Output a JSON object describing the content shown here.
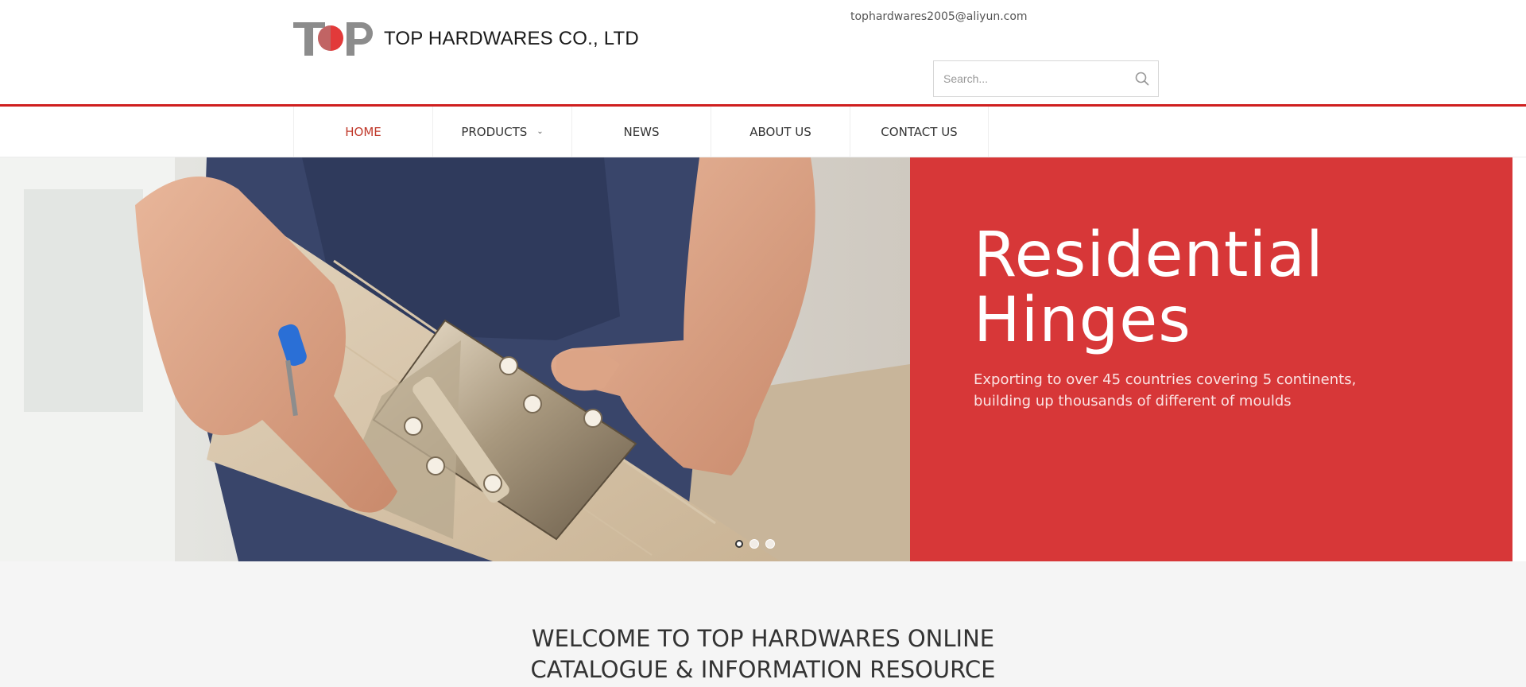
{
  "header": {
    "company_name": "TOP HARDWARES CO., LTD",
    "email": "tophardwares2005@aliyun.com",
    "search_placeholder": "Search...",
    "logo_letters": "TOP"
  },
  "nav": {
    "items": [
      {
        "label": "HOME",
        "active": true
      },
      {
        "label": "PRODUCTS",
        "has_dropdown": true
      },
      {
        "label": "NEWS"
      },
      {
        "label": "ABOUT US"
      },
      {
        "label": "CONTACT US"
      }
    ]
  },
  "hero": {
    "title_line1": "Residential",
    "title_line2": "Hinges",
    "subtitle_line1": "Exporting to over 45 countries covering 5 continents,",
    "subtitle_line2": "building up thousands of different of moulds",
    "slides": 3,
    "active_slide": 1
  },
  "welcome": {
    "line1": "WELCOME TO TOP HARDWARES ONLINE",
    "line2": "CATALOGUE & INFORMATION RESOURCE"
  },
  "colors": {
    "accent_red": "#cf1f1f",
    "hero_panel": "#d73738",
    "nav_active": "#c0392b"
  }
}
